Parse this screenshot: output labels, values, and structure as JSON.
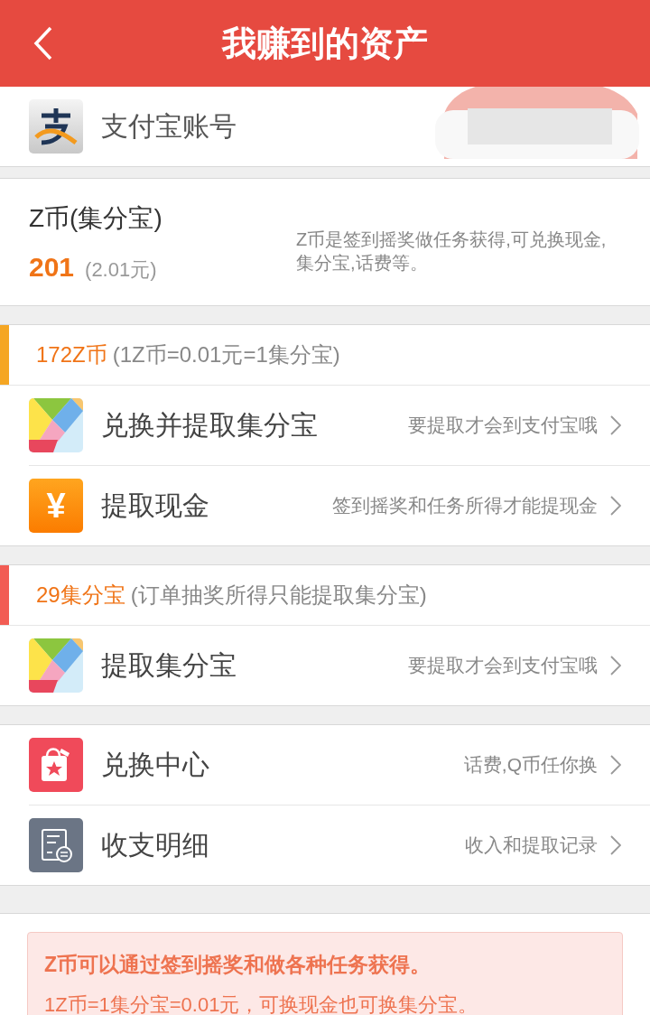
{
  "header": {
    "title": "我赚到的资产"
  },
  "account": {
    "label": "支付宝账号"
  },
  "zcoin": {
    "title": "Z币(集分宝)",
    "amount": "201",
    "amount_note": "(2.01元)",
    "description": "Z币是签到摇奖做任务获得,可兑换现金,集分宝,话费等。"
  },
  "sections": [
    {
      "header": {
        "value": "172Z币",
        "note": "(1Z币=0.01元=1集分宝)",
        "color": "#f5a623"
      },
      "items": [
        {
          "kind": "tangram",
          "title": "兑换并提取集分宝",
          "hint": "要提取才会到支付宝哦"
        },
        {
          "kind": "yuan",
          "glyph": "¥",
          "title": "提取现金",
          "hint": "签到摇奖和任务所得才能提现金"
        }
      ]
    },
    {
      "header": {
        "value": "29集分宝",
        "note": "(订单抽奖所得只能提取集分宝)",
        "color": "#f25c54"
      },
      "items": [
        {
          "kind": "tangram",
          "title": "提取集分宝",
          "hint": "要提取才会到支付宝哦"
        }
      ]
    },
    {
      "items": [
        {
          "kind": "bag",
          "title": "兑换中心",
          "hint": "话费,Q币任你换"
        },
        {
          "kind": "ledger",
          "title": "收支明细",
          "hint": "收入和提取记录"
        }
      ]
    }
  ],
  "notice": {
    "lines": [
      "Z币可以通过签到摇奖和做各种任务获得。",
      "1Z币=1集分宝=0.01元，可换现金也可换集分宝。"
    ]
  }
}
